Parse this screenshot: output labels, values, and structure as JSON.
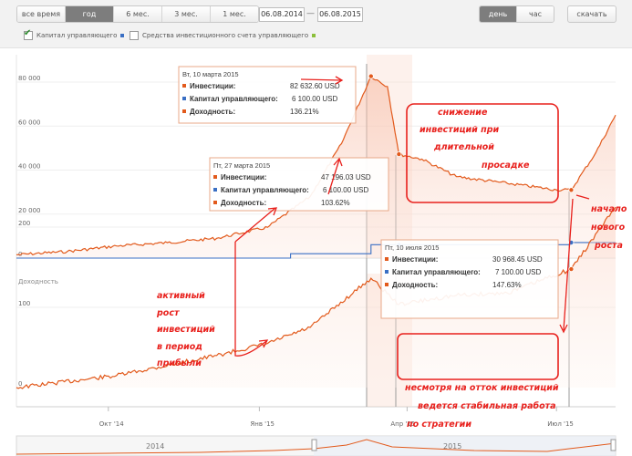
{
  "period_buttons": [
    "все время",
    "год",
    "6 мес.",
    "3 мес.",
    "1 мес."
  ],
  "active_period_index": 1,
  "date_from": "06.08.2014",
  "date_to": "06.08.2015",
  "date_separator": "—",
  "granularity_buttons": [
    "день",
    "час"
  ],
  "active_granularity_index": 0,
  "download_label": "скачать",
  "legend": [
    {
      "label": "Капитал управляющего",
      "checked": true,
      "color": "#3a6fc4"
    },
    {
      "label": "Средства инвестиционного счета управляющего",
      "checked": false,
      "color": "#8bbf3a"
    }
  ],
  "top_axis": {
    "ticks": [
      "80 000",
      "60 000",
      "40 000",
      "20 000",
      "0"
    ]
  },
  "bottom_axis": {
    "title": "Доходность",
    "ticks": [
      "200",
      "100",
      "0"
    ]
  },
  "x_axis": {
    "ticks": [
      "Окт '14",
      "Янв '15",
      "Апр '15",
      "Июл '15"
    ]
  },
  "navigator": {
    "labels": [
      "2014",
      "2015"
    ]
  },
  "tooltips": [
    {
      "date": "Вт, 10 марта 2015",
      "rows": [
        {
          "label": "Инвестиции:",
          "value": "82 632.60  USD",
          "color": "#e25a1c"
        },
        {
          "label": "Капитал управляющего:",
          "value": "6 100.00  USD",
          "color": "#3a6fc4"
        },
        {
          "label": "Доходность:",
          "value": "136.21%",
          "color": "#e25a1c"
        }
      ]
    },
    {
      "date": "Пт, 27 марта 2015",
      "rows": [
        {
          "label": "Инвестиции:",
          "value": "47 196.03  USD",
          "color": "#e25a1c"
        },
        {
          "label": "Капитал управляющего:",
          "value": "6 100.00  USD",
          "color": "#3a6fc4"
        },
        {
          "label": "Доходность:",
          "value": "103.62%",
          "color": "#e25a1c"
        }
      ]
    },
    {
      "date": "Пт, 10 июля 2015",
      "rows": [
        {
          "label": "Инвестиции:",
          "value": "30 968.45  USD",
          "color": "#e25a1c"
        },
        {
          "label": "Капитал управляющего:",
          "value": "7 100.00  USD",
          "color": "#3a6fc4"
        },
        {
          "label": "Доходность:",
          "value": "147.63%",
          "color": "#e25a1c"
        }
      ]
    }
  ],
  "annotations": {
    "decline": [
      "снижение",
      "инвестиций при",
      "длительной",
      "просадке"
    ],
    "growth": [
      "активный",
      "рост",
      "инвестиций",
      "в период",
      "прибыли"
    ],
    "new_growth": [
      "начало",
      "нового",
      "роста"
    ],
    "stable": [
      "несмотря на отток инвестиций",
      "ведется стабильная работа",
      "по стратегии"
    ]
  },
  "colors": {
    "investments": "#e25a1c",
    "manager_capital": "#3a6fc4",
    "annotation": "#e8201c"
  },
  "chart_data": [
    {
      "type": "area",
      "series": [
        {
          "name": "Инвестиции",
          "x": [
            "2014-08-06",
            "2014-09-06",
            "2014-10-06",
            "2014-11-06",
            "2014-12-06",
            "2015-01-06",
            "2015-02-01",
            "2015-02-20",
            "2015-03-10",
            "2015-03-20",
            "2015-03-27",
            "2015-04-10",
            "2015-05-01",
            "2015-06-01",
            "2015-07-01",
            "2015-07-10",
            "2015-07-25",
            "2015-08-06"
          ],
          "y": [
            1500,
            3000,
            5500,
            7000,
            9000,
            14000,
            28000,
            52000,
            82632.6,
            78000,
            47196.03,
            45000,
            37000,
            34000,
            31000,
            30968.45,
            48000,
            65000
          ]
        },
        {
          "name": "Капитал управляющего",
          "x": [
            "2014-08-06",
            "2015-01-20",
            "2015-03-10",
            "2015-07-10",
            "2015-08-06"
          ],
          "y": [
            0,
            2000,
            6100,
            7100,
            7100
          ]
        }
      ],
      "ylim": [
        0,
        85000
      ]
    },
    {
      "type": "line",
      "series": [
        {
          "name": "Доходность",
          "x": [
            "2014-08-06",
            "2014-10-06",
            "2014-12-06",
            "2015-01-06",
            "2015-02-01",
            "2015-03-10",
            "2015-03-27",
            "2015-05-01",
            "2015-06-01",
            "2015-07-10",
            "2015-08-06"
          ],
          "y": [
            0,
            15,
            40,
            55,
            75,
            136.21,
            103.62,
            115,
            118,
            147.63,
            225
          ]
        }
      ],
      "ylim": [
        0,
        230
      ]
    }
  ]
}
